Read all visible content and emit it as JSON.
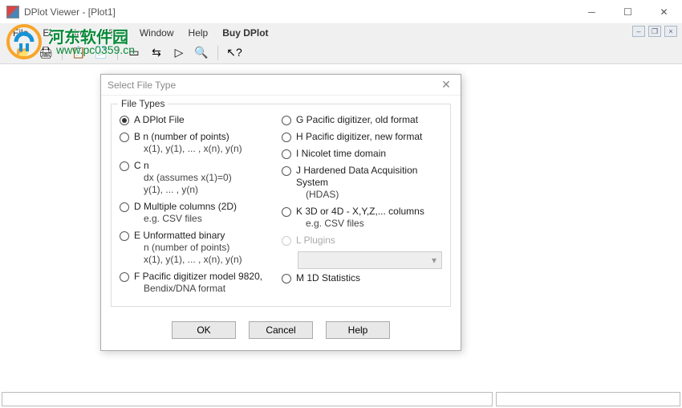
{
  "window": {
    "title": "DPlot Viewer - [Plot1]"
  },
  "menu": {
    "items": [
      "File",
      "Edit",
      "Info",
      "View",
      "Window",
      "Help",
      "Buy DPlot"
    ]
  },
  "watermark": {
    "text": "河东软件园",
    "url": "www.pc0359.cn"
  },
  "dialog": {
    "title": "Select File Type",
    "group": "File Types",
    "options_left": [
      {
        "key": "A",
        "label": "DPlot File",
        "checked": true
      },
      {
        "key": "B",
        "label": "n (number of points)",
        "sub": "x(1), y(1), ... , x(n), y(n)"
      },
      {
        "key": "C",
        "label": "n",
        "sub": "dx     (assumes x(1)=0)\ny(1), ... , y(n)"
      },
      {
        "key": "D",
        "label": "Multiple columns (2D)",
        "sub": "e.g. CSV files"
      },
      {
        "key": "E",
        "label": "Unformatted binary",
        "sub": "n (number of points)\nx(1), y(1), ... , x(n), y(n)"
      },
      {
        "key": "F",
        "label": "Pacific digitizer model 9820,",
        "sub": "Bendix/DNA format"
      }
    ],
    "options_right": [
      {
        "key": "G",
        "label": "Pacific digitizer, old format"
      },
      {
        "key": "H",
        "label": "Pacific digitizer, new format"
      },
      {
        "key": "I",
        "label": "Nicolet time domain"
      },
      {
        "key": "J",
        "label": "Hardened Data Acquisition System",
        "sub": "(HDAS)"
      },
      {
        "key": "K",
        "label": "3D or 4D - X,Y,Z,... columns",
        "sub": "e.g. CSV files"
      },
      {
        "key": "L",
        "label": "Plugins",
        "disabled": true,
        "hasSelect": true
      },
      {
        "key": "M",
        "label": "1D Statistics"
      }
    ],
    "buttons": {
      "ok": "OK",
      "cancel": "Cancel",
      "help": "Help"
    }
  }
}
